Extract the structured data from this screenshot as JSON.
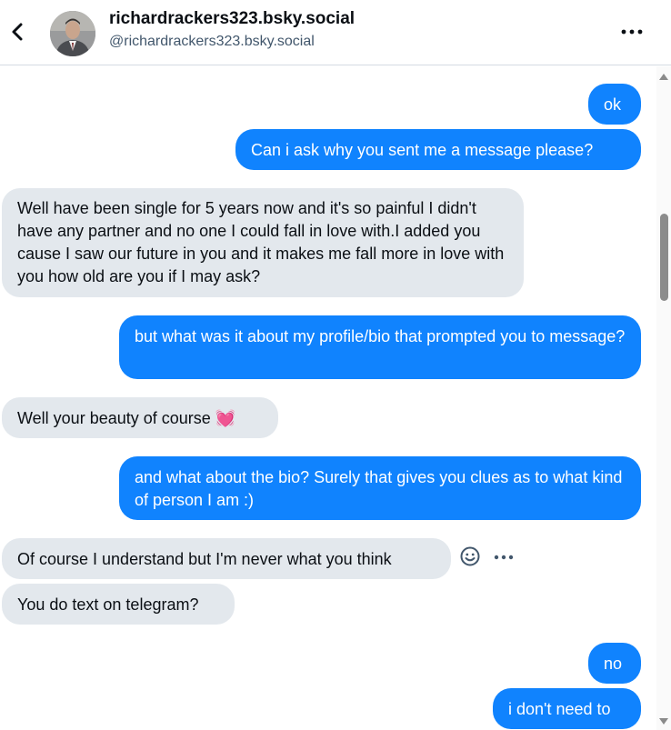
{
  "header": {
    "display_name": "richardrackers323.bsky.social",
    "handle": "@richardrackers323.bsky.social",
    "back_icon": "chevron-left-icon",
    "more_icon": "more-horizontal-icon"
  },
  "messages": [
    {
      "direction": "out",
      "text": "ok"
    },
    {
      "direction": "out",
      "text": "Can i ask why you sent me a message please?"
    },
    {
      "direction": "in",
      "text": "Well have been single for 5 years now and it's so painful I didn't have any partner and no one I could fall in love with.I added you cause I saw our future in you and it makes me fall more in love with you how old are you if I may ask?"
    },
    {
      "direction": "out",
      "text": "but what was it about my profile/bio that prompted you to message?"
    },
    {
      "direction": "in",
      "text": "Well your beauty of course 💓"
    },
    {
      "direction": "out",
      "text": "and what about the bio?  Surely that gives you clues as to what kind of person I am :)"
    },
    {
      "direction": "in",
      "text": "Of course I understand but I'm never what you think"
    },
    {
      "direction": "in",
      "text": "You do text on telegram?"
    },
    {
      "direction": "out",
      "text": "no"
    },
    {
      "direction": "out",
      "text": "i don't need to"
    }
  ],
  "colors": {
    "outgoing_bubble": "#1083fe",
    "incoming_bubble": "#e3e8ed"
  }
}
